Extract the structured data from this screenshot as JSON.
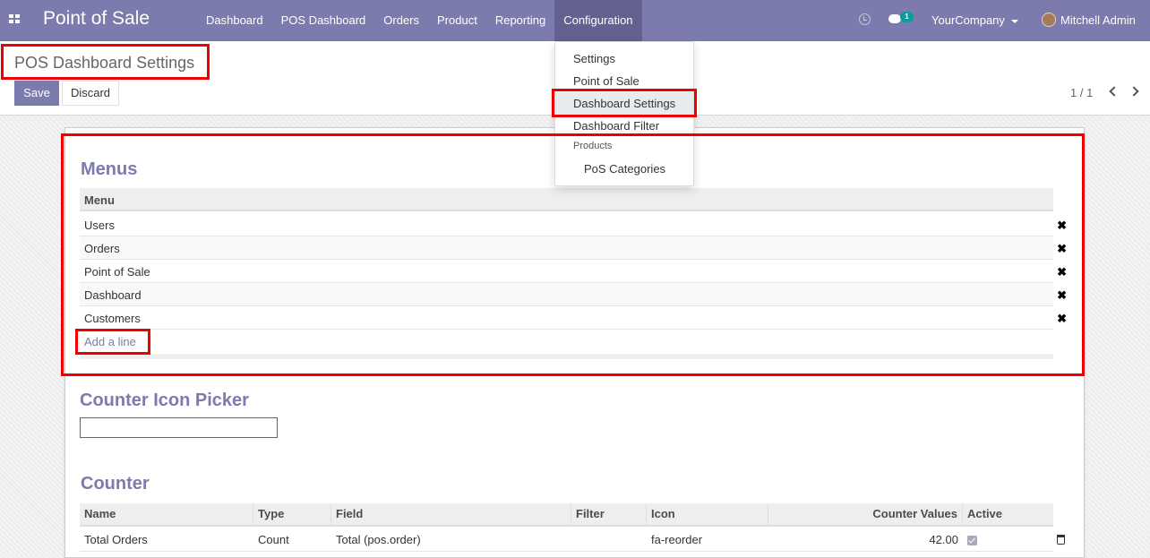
{
  "topbar": {
    "app_name": "Point of Sale",
    "menus": [
      "Dashboard",
      "POS Dashboard",
      "Orders",
      "Product",
      "Reporting",
      "Configuration"
    ],
    "active_menu": "Configuration",
    "chat_count": "1",
    "company": "YourCompany",
    "user": "Mitchell Admin"
  },
  "control_panel": {
    "breadcrumb": "POS Dashboard Settings",
    "save_label": "Save",
    "discard_label": "Discard",
    "pager": "1 / 1"
  },
  "config_dropdown": {
    "items": [
      "Settings",
      "Point of Sale",
      "Dashboard Settings",
      "Dashboard Filter"
    ],
    "active_item": "Dashboard Settings",
    "section_header": "Products",
    "section_items": [
      "PoS Categories"
    ]
  },
  "menus_section": {
    "title": "Menus",
    "column_header": "Menu",
    "rows": [
      "Users",
      "Orders",
      "Point of Sale",
      "Dashboard",
      "Customers"
    ],
    "add_line": "Add a line"
  },
  "icon_picker": {
    "title": "Counter Icon Picker",
    "value": ""
  },
  "counter_section": {
    "title": "Counter",
    "columns": [
      "Name",
      "Type",
      "Field",
      "Filter",
      "Icon",
      "Counter Values",
      "Active"
    ],
    "rows": [
      {
        "name": "Total Orders",
        "type": "Count",
        "field": "Total (pos.order)",
        "filter": "",
        "icon": "fa-reorder",
        "counter_values": "42.00",
        "active": true
      }
    ]
  },
  "colors": {
    "brand": "#7c7bad",
    "highlight": "#ee0000"
  }
}
